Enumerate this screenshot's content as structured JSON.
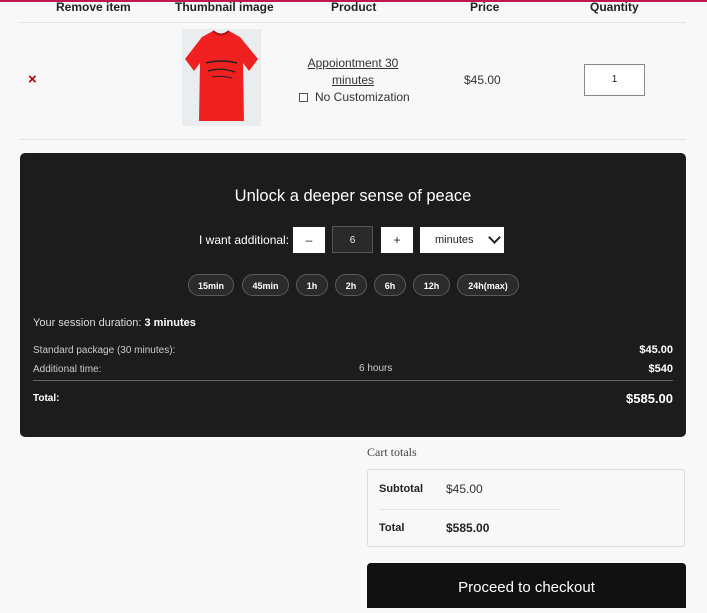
{
  "table": {
    "headers": [
      "Remove item",
      "Thumbnail image",
      "Product",
      "Price",
      "Quantity"
    ]
  },
  "cart_item": {
    "remove_symbol": "×",
    "thumbnail_icon": "red-tshirt-image",
    "product_name": "Appoiontment 30 minutes",
    "product_line1": "Appoiontment 30",
    "product_line2": "minutes",
    "customization_label": "No Customization",
    "price": "$45.00",
    "quantity": "1"
  },
  "upsell": {
    "title": "Unlock a deeper sense of peace",
    "want_label": "I want additional:",
    "minus_label": "–",
    "amount": "6",
    "plus_label": "+",
    "unit_selected": "minutes",
    "presets": [
      "15min",
      "45min",
      "1h",
      "2h",
      "6h",
      "12h",
      "24h(max)"
    ],
    "duration_label": "Your session duration: ",
    "duration_value": "3 minutes",
    "standard_label": "Standard package (30 minutes):",
    "standard_value": "$45.00",
    "additional_label": "Additional time:",
    "additional_mid": "6 hours",
    "additional_value": "$540",
    "total_label": "Total:",
    "total_value": "$585.00"
  },
  "cart_totals": {
    "title": "Cart totals",
    "subtotal_label": "Subtotal",
    "subtotal_value": "$45.00",
    "total_label": "Total",
    "total_value": "$585.00",
    "checkout_label": "Proceed to checkout"
  },
  "colors": {
    "accent_line": "#c0174f",
    "panel_bg": "#1c1c1c",
    "remove_red": "#b00000",
    "shirt_red": "#ee2020"
  }
}
